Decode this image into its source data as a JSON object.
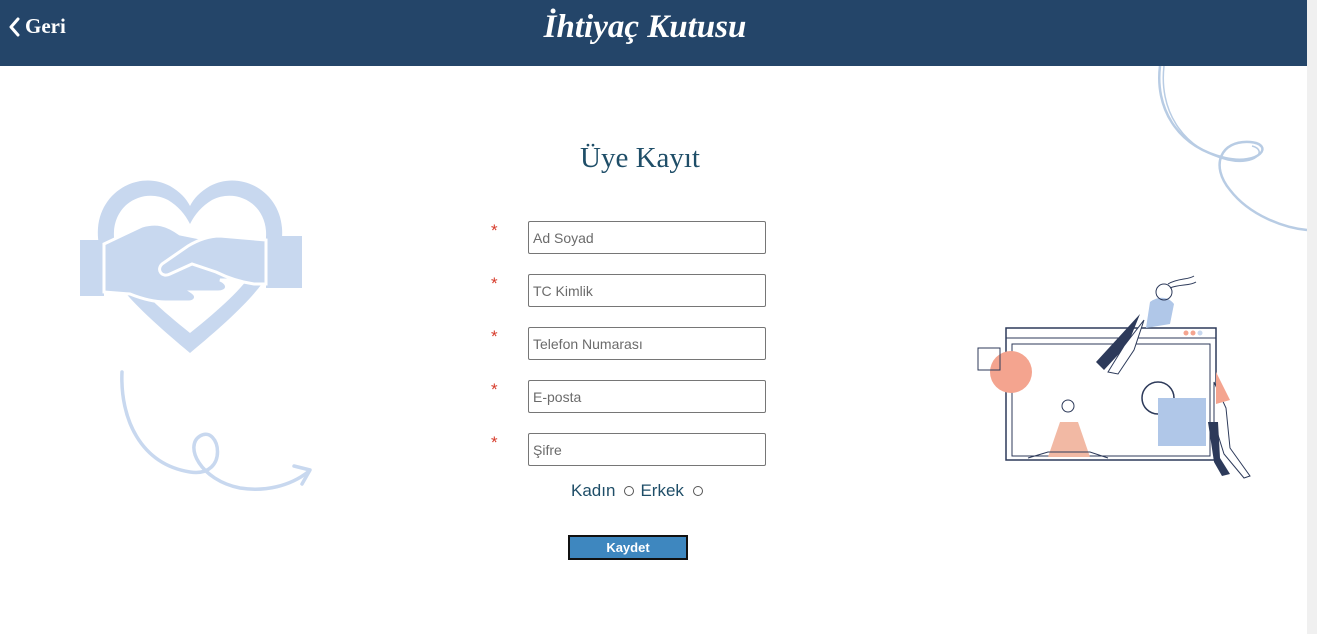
{
  "header": {
    "back_label": "Geri",
    "app_title": "İhtiyaç Kutusu",
    "background_color": "#244569"
  },
  "form": {
    "title": "Üye Kayıt",
    "required_mark": "*",
    "fields": [
      {
        "placeholder": "Ad Soyad",
        "value": ""
      },
      {
        "placeholder": "TC Kimlik",
        "value": ""
      },
      {
        "placeholder": "Telefon Numarası",
        "value": ""
      },
      {
        "placeholder": "E-posta",
        "value": ""
      },
      {
        "placeholder": "Şifre",
        "value": ""
      }
    ],
    "gender": {
      "female_label": "Kadın",
      "male_label": "Erkek",
      "selected": null
    },
    "submit_label": "Kaydet",
    "submit_color": "#3e87bf"
  },
  "illustrations": {
    "left": "heart-handshake-icon",
    "right": "people-browser-window-illustration",
    "accent_color": "#c8d8ef",
    "peach_color": "#f4a48f"
  }
}
